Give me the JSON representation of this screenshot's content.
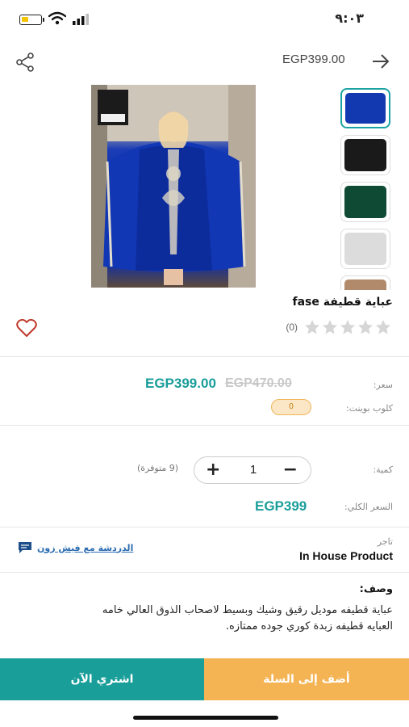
{
  "status_bar": {
    "time": "٩:٠٣"
  },
  "header": {
    "price": "EGP399.00"
  },
  "gallery": {
    "thumbnail_colors": [
      "#1239b0",
      "#1a1a1a",
      "#0f4a35",
      "#dcdcdc",
      "#b08a6b"
    ]
  },
  "product": {
    "title": "عباية قطيفة fase",
    "rating_count": "(0)",
    "stars": 5
  },
  "pricing": {
    "price_label": "سعر:",
    "current_price": "EGP399.00",
    "old_price": "EGP470.00",
    "club_label": "كلوب بوينت:",
    "club_points": "0"
  },
  "quantity": {
    "label": "كمية:",
    "value": "1",
    "available": "(9 متوفرة)",
    "plus": "+",
    "minus": "−"
  },
  "total": {
    "label": "السعر الكلي:",
    "value": "EGP399"
  },
  "seller": {
    "label": "تاجر",
    "name": "In House Product",
    "chat_link": "الدردشة مع فيش زون"
  },
  "description": {
    "title": "وصف:",
    "text": "عباية قطيفه موديل رقيق وشيك وبسيط لاصحاب الذوق العالي خامه العبايه قطيفه زبدة كوري جوده ممتازه."
  },
  "actions": {
    "buy_now": "اشتري الآن",
    "add_to_cart": "أضف إلى السلة"
  },
  "colors": {
    "accent": "#1a9e9a",
    "cart": "#f4b454",
    "link": "#2b6cb0"
  }
}
